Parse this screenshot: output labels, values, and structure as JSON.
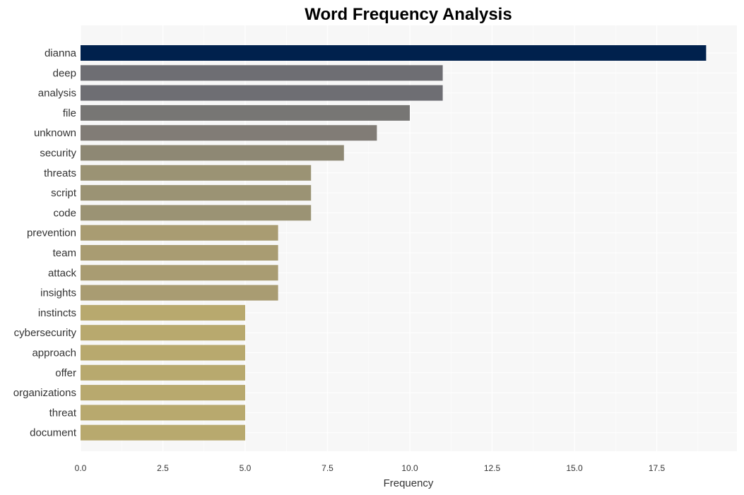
{
  "chart_data": {
    "type": "bar",
    "orientation": "horizontal",
    "title": "Word Frequency Analysis",
    "xlabel": "Frequency",
    "ylabel": "",
    "xlim": [
      0,
      19.9
    ],
    "xticks": [
      0,
      2.5,
      5,
      7.5,
      10,
      12.5,
      15,
      17.5
    ],
    "xtick_labels": [
      "0.0",
      "2.5",
      "5.0",
      "7.5",
      "10.0",
      "12.5",
      "15.0",
      "17.5"
    ],
    "grid": true,
    "categories": [
      "dianna",
      "deep",
      "analysis",
      "file",
      "unknown",
      "security",
      "threats",
      "script",
      "code",
      "prevention",
      "team",
      "attack",
      "insights",
      "instincts",
      "cybersecurity",
      "approach",
      "offer",
      "organizations",
      "threat",
      "document"
    ],
    "values": [
      19,
      11,
      11,
      10,
      9,
      8,
      7,
      7,
      7,
      6,
      6,
      6,
      6,
      5,
      5,
      5,
      5,
      5,
      5,
      5
    ],
    "colors": [
      "#00214d",
      "#6e6e73",
      "#6e6e73",
      "#777674",
      "#817c76",
      "#8e8874",
      "#9b9374",
      "#9b9374",
      "#9b9374",
      "#a99c72",
      "#a99c72",
      "#a99c72",
      "#a99c72",
      "#b8a96e",
      "#b8a96e",
      "#b8a96e",
      "#b8a96e",
      "#b8a96e",
      "#b8a96e",
      "#b8a96e"
    ],
    "plot_background": "#f7f7f7"
  }
}
